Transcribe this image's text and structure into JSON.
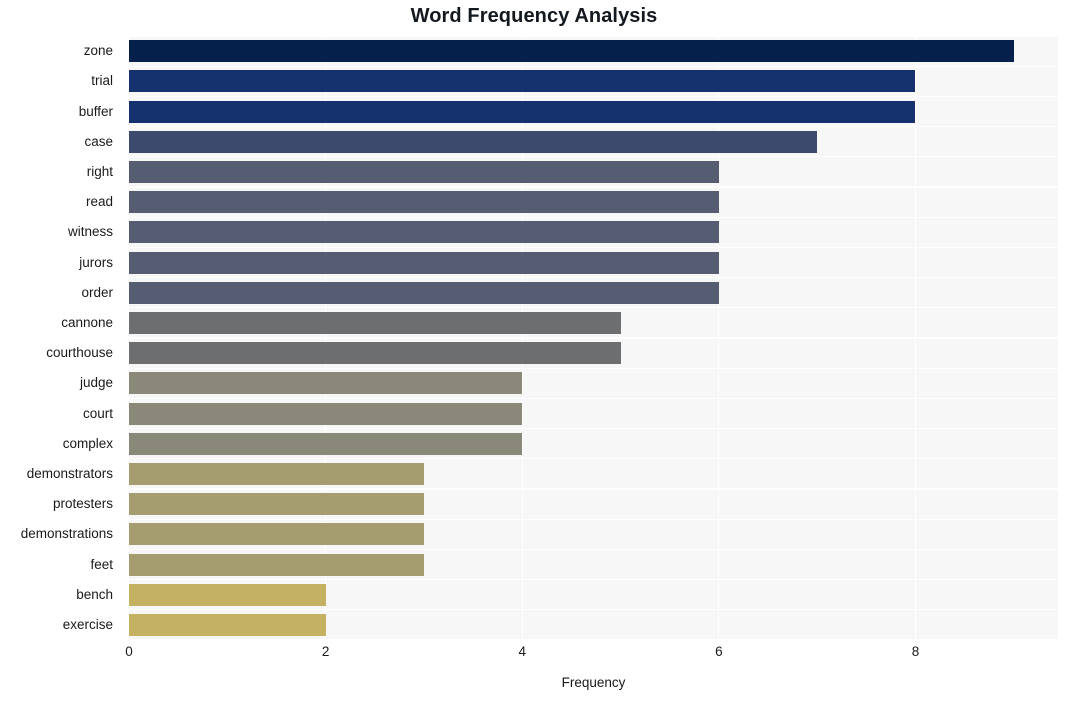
{
  "chart_data": {
    "type": "bar",
    "orientation": "horizontal",
    "title": "Word Frequency Analysis",
    "xlabel": "Frequency",
    "ylabel": "",
    "categories": [
      "zone",
      "trial",
      "buffer",
      "case",
      "right",
      "read",
      "witness",
      "jurors",
      "order",
      "cannone",
      "courthouse",
      "judge",
      "court",
      "complex",
      "demonstrators",
      "protesters",
      "demonstrations",
      "feet",
      "bench",
      "exercise"
    ],
    "values": [
      9,
      8,
      8,
      7,
      6,
      6,
      6,
      6,
      6,
      5,
      5,
      4,
      4,
      4,
      3,
      3,
      3,
      3,
      2,
      2
    ],
    "bar_colors": [
      "#05204a",
      "#15326f",
      "#15326f",
      "#3c4a6e",
      "#565c72",
      "#565c72",
      "#565c72",
      "#565c72",
      "#565c72",
      "#6d6e70",
      "#6d6e70",
      "#8a8878",
      "#8a8878",
      "#8a8878",
      "#a59c70",
      "#a59c70",
      "#a59c70",
      "#a59c70",
      "#c4b161",
      "#c4b161"
    ],
    "xlim": [
      0,
      9.45
    ],
    "xticks": [
      0,
      2,
      4,
      6,
      8
    ],
    "xtick_labels": [
      "0",
      "2",
      "4",
      "6",
      "8"
    ],
    "grid": true,
    "grid_color": "#ffffff",
    "plot_background": "#f7f7f7",
    "figure_background": "#ffffff",
    "legend": null,
    "annotations": []
  },
  "figure": {
    "title": "Word Frequency Analysis",
    "axis_x_title": "Frequency"
  }
}
